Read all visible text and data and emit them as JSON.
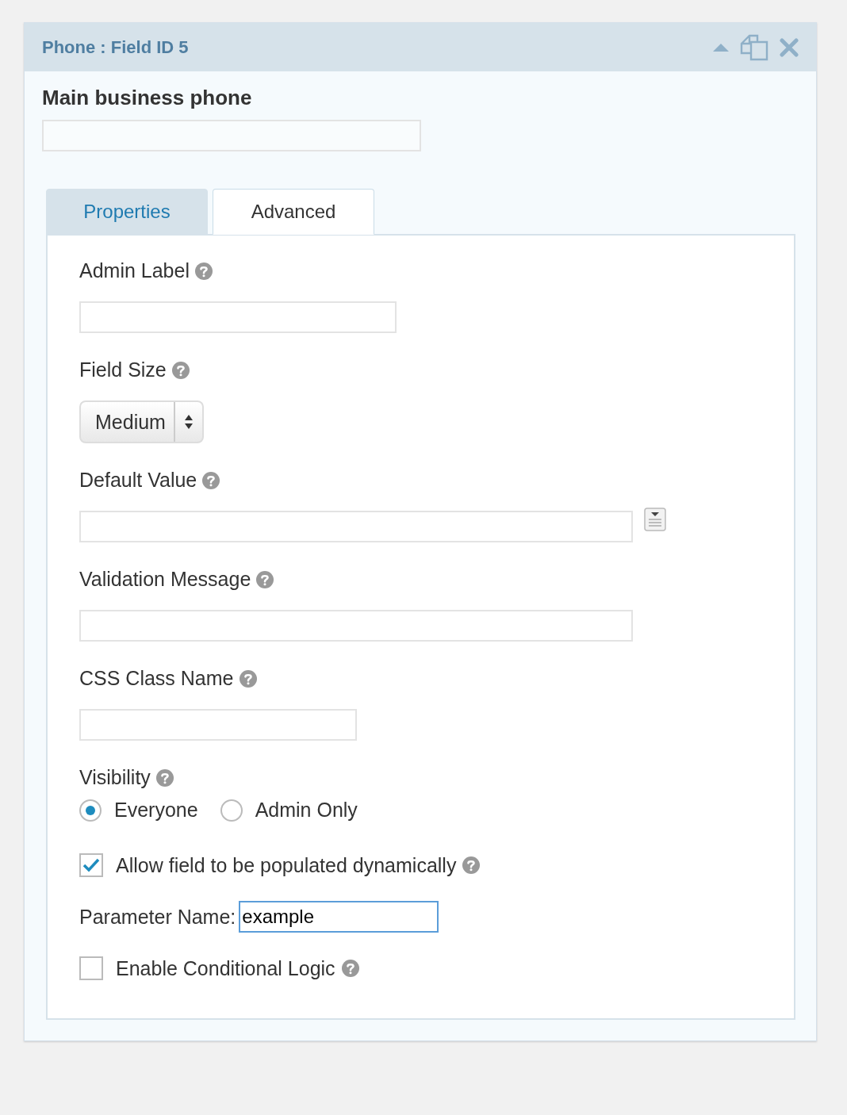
{
  "panel": {
    "title": "Phone : Field ID 5"
  },
  "field_label": "Main business phone",
  "tabs": [
    {
      "label": "Properties",
      "selected": false
    },
    {
      "label": "Advanced",
      "selected": true
    }
  ],
  "settings": [
    {
      "kind": "text",
      "label": "Admin Label"
    },
    {
      "kind": "select",
      "label": "Field Size",
      "value": "Medium"
    },
    {
      "kind": "mergetext",
      "label": "Default Value"
    },
    {
      "kind": "longtext",
      "label": "Validation Message"
    },
    {
      "kind": "shorttext",
      "label": "CSS Class Name"
    },
    {
      "kind": "radio",
      "label": "Visibility",
      "options": [
        {
          "label": "Everyone",
          "selected": true
        },
        {
          "label": "Admin Only",
          "selected": false
        }
      ]
    },
    {
      "kind": "checkbox",
      "label": "Allow field to be populated dynamically",
      "checked": true
    },
    {
      "kind": "param",
      "label": "Parameter Name:",
      "value": "example",
      "focused": true
    },
    {
      "kind": "checkbox",
      "label": "Enable Conditional Logic",
      "checked": false
    }
  ]
}
